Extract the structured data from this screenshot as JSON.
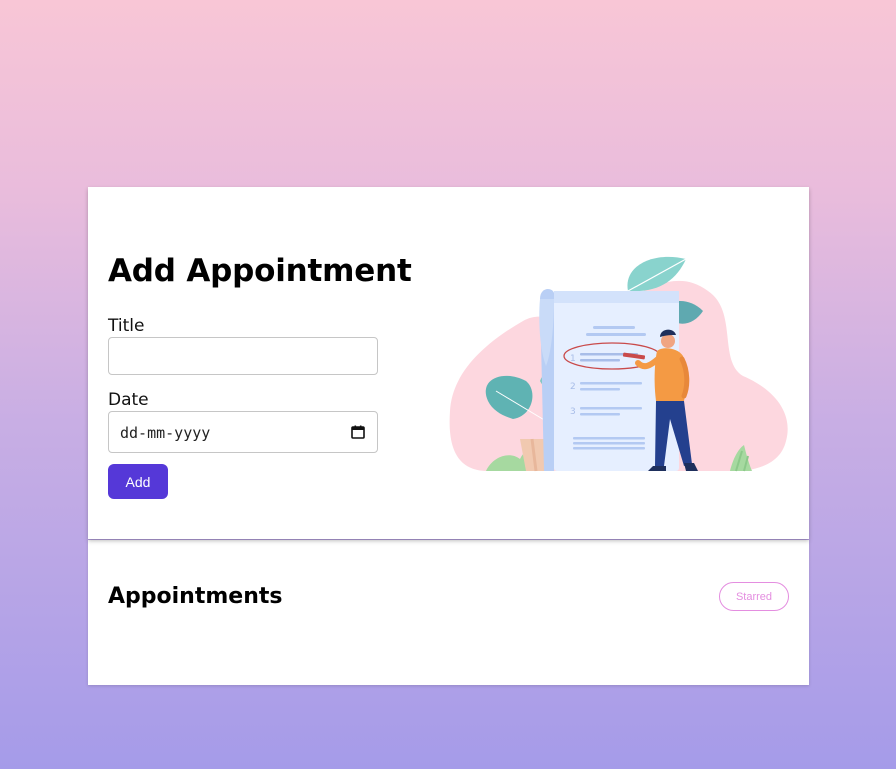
{
  "add_form": {
    "heading": "Add Appointment",
    "title_label": "Title",
    "title_value": "",
    "date_label": "Date",
    "date_placeholder": "dd-mm-yyyy",
    "submit_label": "Add"
  },
  "appointments": {
    "heading": "Appointments",
    "filter_label": "Starred"
  },
  "colors": {
    "primary_button": "#5538d8",
    "starred_accent": "#e48ee0",
    "illustration_blob": "#fdd7df",
    "illustration_leaf": "#5fb3b3"
  },
  "icons": {
    "calendar": "calendar-icon"
  }
}
